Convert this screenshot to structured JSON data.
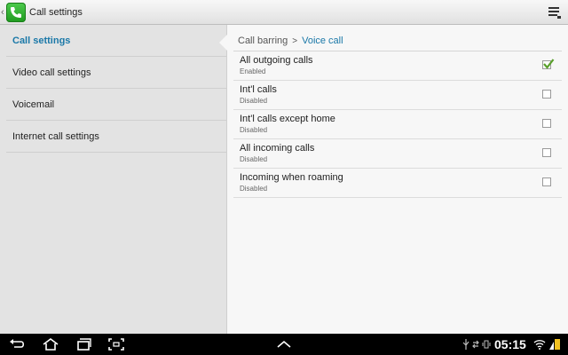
{
  "header": {
    "title": "Call settings"
  },
  "left_menu": {
    "items": [
      {
        "label": "Call settings",
        "active": true
      },
      {
        "label": "Video call settings",
        "active": false
      },
      {
        "label": "Voicemail",
        "active": false
      },
      {
        "label": "Internet call settings",
        "active": false
      }
    ]
  },
  "breadcrumb": {
    "parent": "Call barring",
    "current": "Voice call"
  },
  "settings": [
    {
      "title": "All outgoing calls",
      "status": "Enabled",
      "checked": true
    },
    {
      "title": "Int'l calls",
      "status": "Disabled",
      "checked": false
    },
    {
      "title": "Int'l calls except home",
      "status": "Disabled",
      "checked": false
    },
    {
      "title": "All incoming calls",
      "status": "Disabled",
      "checked": false
    },
    {
      "title": "Incoming when roaming",
      "status": "Disabled",
      "checked": false
    }
  ],
  "status_bar": {
    "time": "05:15"
  },
  "colors": {
    "accent": "#1a78a8",
    "check": "#5aa02c",
    "app_icon": "#3bb53b"
  },
  "icons": {
    "app": "phone-app-icon",
    "overflow": "overflow-menu-icon",
    "nav": [
      "back-icon",
      "home-icon",
      "recent-apps-icon",
      "screenshot-icon",
      "chevron-up-icon"
    ],
    "status": [
      "usb-icon",
      "sync-icon",
      "vibrate-icon",
      "wifi-icon",
      "battery-icon"
    ]
  }
}
